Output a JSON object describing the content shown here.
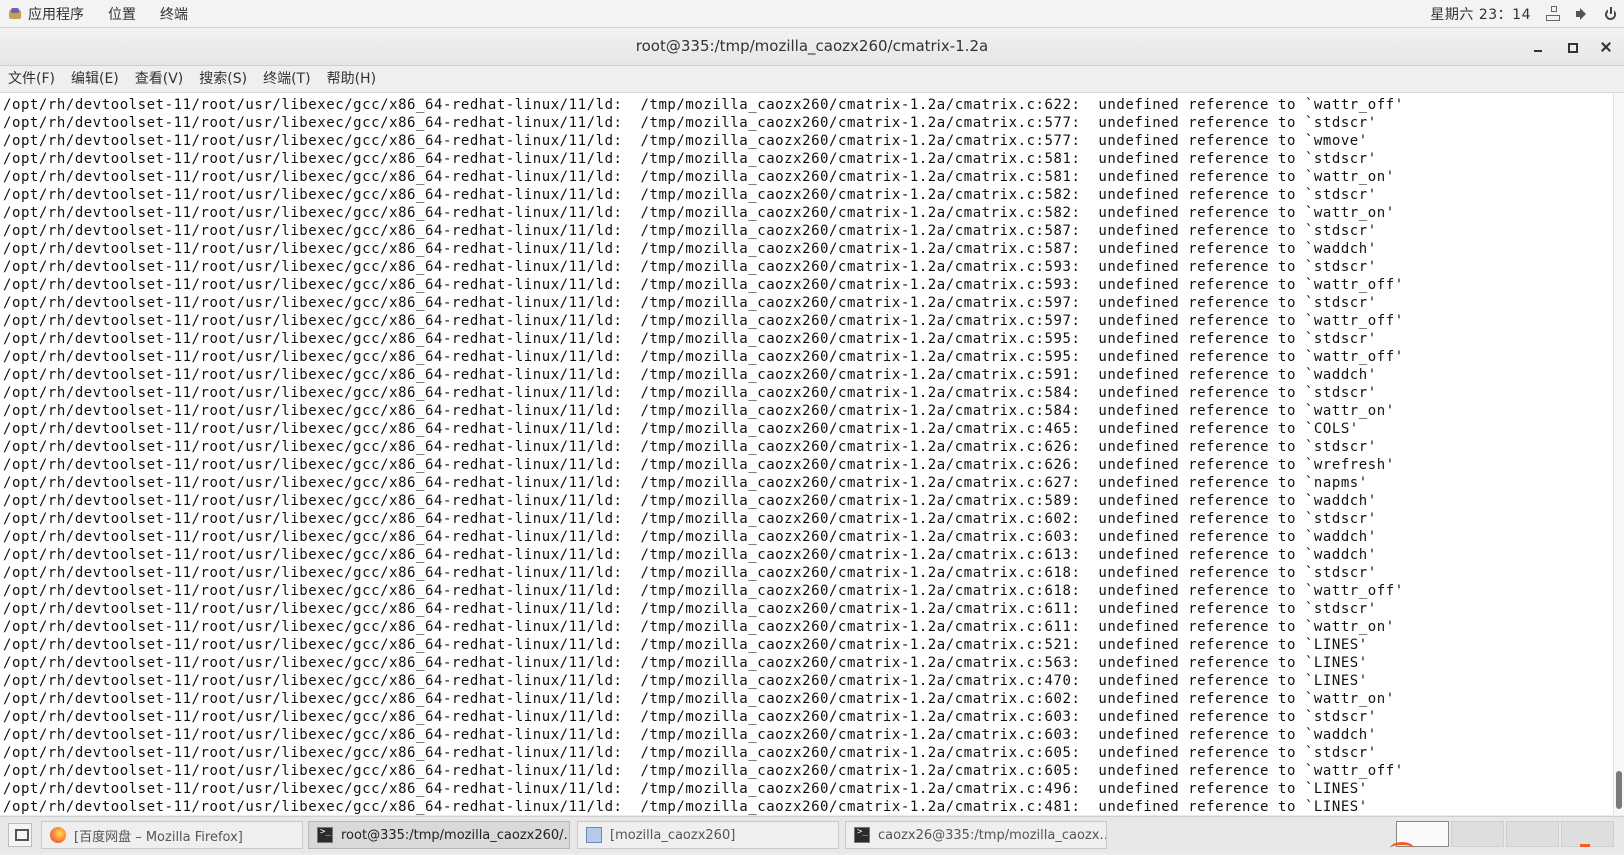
{
  "top_panel": {
    "applications": "应用程序",
    "places": "位置",
    "terminal": "终端",
    "datetime": "星期六 23：14"
  },
  "window": {
    "title": "root@335:/tmp/mozilla_caozx260/cmatrix-1.2a"
  },
  "menu": {
    "items": [
      "文件(F)",
      "编辑(E)",
      "查看(V)",
      "搜索(S)",
      "终端(T)",
      "帮助(H)"
    ]
  },
  "terminal": {
    "lines": [
      "/opt/rh/devtoolset-11/root/usr/libexec/gcc/x86_64-redhat-linux/11/ld:  /tmp/mozilla_caozx260/cmatrix-1.2a/cmatrix.c:622:  undefined reference to `wattr_off'",
      "/opt/rh/devtoolset-11/root/usr/libexec/gcc/x86_64-redhat-linux/11/ld:  /tmp/mozilla_caozx260/cmatrix-1.2a/cmatrix.c:577:  undefined reference to `stdscr'",
      "/opt/rh/devtoolset-11/root/usr/libexec/gcc/x86_64-redhat-linux/11/ld:  /tmp/mozilla_caozx260/cmatrix-1.2a/cmatrix.c:577:  undefined reference to `wmove'",
      "/opt/rh/devtoolset-11/root/usr/libexec/gcc/x86_64-redhat-linux/11/ld:  /tmp/mozilla_caozx260/cmatrix-1.2a/cmatrix.c:581:  undefined reference to `stdscr'",
      "/opt/rh/devtoolset-11/root/usr/libexec/gcc/x86_64-redhat-linux/11/ld:  /tmp/mozilla_caozx260/cmatrix-1.2a/cmatrix.c:581:  undefined reference to `wattr_on'",
      "/opt/rh/devtoolset-11/root/usr/libexec/gcc/x86_64-redhat-linux/11/ld:  /tmp/mozilla_caozx260/cmatrix-1.2a/cmatrix.c:582:  undefined reference to `stdscr'",
      "/opt/rh/devtoolset-11/root/usr/libexec/gcc/x86_64-redhat-linux/11/ld:  /tmp/mozilla_caozx260/cmatrix-1.2a/cmatrix.c:582:  undefined reference to `wattr_on'",
      "/opt/rh/devtoolset-11/root/usr/libexec/gcc/x86_64-redhat-linux/11/ld:  /tmp/mozilla_caozx260/cmatrix-1.2a/cmatrix.c:587:  undefined reference to `stdscr'",
      "/opt/rh/devtoolset-11/root/usr/libexec/gcc/x86_64-redhat-linux/11/ld:  /tmp/mozilla_caozx260/cmatrix-1.2a/cmatrix.c:587:  undefined reference to `waddch'",
      "/opt/rh/devtoolset-11/root/usr/libexec/gcc/x86_64-redhat-linux/11/ld:  /tmp/mozilla_caozx260/cmatrix-1.2a/cmatrix.c:593:  undefined reference to `stdscr'",
      "/opt/rh/devtoolset-11/root/usr/libexec/gcc/x86_64-redhat-linux/11/ld:  /tmp/mozilla_caozx260/cmatrix-1.2a/cmatrix.c:593:  undefined reference to `wattr_off'",
      "/opt/rh/devtoolset-11/root/usr/libexec/gcc/x86_64-redhat-linux/11/ld:  /tmp/mozilla_caozx260/cmatrix-1.2a/cmatrix.c:597:  undefined reference to `stdscr'",
      "/opt/rh/devtoolset-11/root/usr/libexec/gcc/x86_64-redhat-linux/11/ld:  /tmp/mozilla_caozx260/cmatrix-1.2a/cmatrix.c:597:  undefined reference to `wattr_off'",
      "/opt/rh/devtoolset-11/root/usr/libexec/gcc/x86_64-redhat-linux/11/ld:  /tmp/mozilla_caozx260/cmatrix-1.2a/cmatrix.c:595:  undefined reference to `stdscr'",
      "/opt/rh/devtoolset-11/root/usr/libexec/gcc/x86_64-redhat-linux/11/ld:  /tmp/mozilla_caozx260/cmatrix-1.2a/cmatrix.c:595:  undefined reference to `wattr_off'",
      "/opt/rh/devtoolset-11/root/usr/libexec/gcc/x86_64-redhat-linux/11/ld:  /tmp/mozilla_caozx260/cmatrix-1.2a/cmatrix.c:591:  undefined reference to `waddch'",
      "/opt/rh/devtoolset-11/root/usr/libexec/gcc/x86_64-redhat-linux/11/ld:  /tmp/mozilla_caozx260/cmatrix-1.2a/cmatrix.c:584:  undefined reference to `stdscr'",
      "/opt/rh/devtoolset-11/root/usr/libexec/gcc/x86_64-redhat-linux/11/ld:  /tmp/mozilla_caozx260/cmatrix-1.2a/cmatrix.c:584:  undefined reference to `wattr_on'",
      "/opt/rh/devtoolset-11/root/usr/libexec/gcc/x86_64-redhat-linux/11/ld:  /tmp/mozilla_caozx260/cmatrix-1.2a/cmatrix.c:465:  undefined reference to `COLS'",
      "/opt/rh/devtoolset-11/root/usr/libexec/gcc/x86_64-redhat-linux/11/ld:  /tmp/mozilla_caozx260/cmatrix-1.2a/cmatrix.c:626:  undefined reference to `stdscr'",
      "/opt/rh/devtoolset-11/root/usr/libexec/gcc/x86_64-redhat-linux/11/ld:  /tmp/mozilla_caozx260/cmatrix-1.2a/cmatrix.c:626:  undefined reference to `wrefresh'",
      "/opt/rh/devtoolset-11/root/usr/libexec/gcc/x86_64-redhat-linux/11/ld:  /tmp/mozilla_caozx260/cmatrix-1.2a/cmatrix.c:627:  undefined reference to `napms'",
      "/opt/rh/devtoolset-11/root/usr/libexec/gcc/x86_64-redhat-linux/11/ld:  /tmp/mozilla_caozx260/cmatrix-1.2a/cmatrix.c:589:  undefined reference to `waddch'",
      "/opt/rh/devtoolset-11/root/usr/libexec/gcc/x86_64-redhat-linux/11/ld:  /tmp/mozilla_caozx260/cmatrix-1.2a/cmatrix.c:602:  undefined reference to `stdscr'",
      "/opt/rh/devtoolset-11/root/usr/libexec/gcc/x86_64-redhat-linux/11/ld:  /tmp/mozilla_caozx260/cmatrix-1.2a/cmatrix.c:603:  undefined reference to `waddch'",
      "/opt/rh/devtoolset-11/root/usr/libexec/gcc/x86_64-redhat-linux/11/ld:  /tmp/mozilla_caozx260/cmatrix-1.2a/cmatrix.c:613:  undefined reference to `waddch'",
      "/opt/rh/devtoolset-11/root/usr/libexec/gcc/x86_64-redhat-linux/11/ld:  /tmp/mozilla_caozx260/cmatrix-1.2a/cmatrix.c:618:  undefined reference to `stdscr'",
      "/opt/rh/devtoolset-11/root/usr/libexec/gcc/x86_64-redhat-linux/11/ld:  /tmp/mozilla_caozx260/cmatrix-1.2a/cmatrix.c:618:  undefined reference to `wattr_off'",
      "/opt/rh/devtoolset-11/root/usr/libexec/gcc/x86_64-redhat-linux/11/ld:  /tmp/mozilla_caozx260/cmatrix-1.2a/cmatrix.c:611:  undefined reference to `stdscr'",
      "/opt/rh/devtoolset-11/root/usr/libexec/gcc/x86_64-redhat-linux/11/ld:  /tmp/mozilla_caozx260/cmatrix-1.2a/cmatrix.c:611:  undefined reference to `wattr_on'",
      "/opt/rh/devtoolset-11/root/usr/libexec/gcc/x86_64-redhat-linux/11/ld:  /tmp/mozilla_caozx260/cmatrix-1.2a/cmatrix.c:521:  undefined reference to `LINES'",
      "/opt/rh/devtoolset-11/root/usr/libexec/gcc/x86_64-redhat-linux/11/ld:  /tmp/mozilla_caozx260/cmatrix-1.2a/cmatrix.c:563:  undefined reference to `LINES'",
      "/opt/rh/devtoolset-11/root/usr/libexec/gcc/x86_64-redhat-linux/11/ld:  /tmp/mozilla_caozx260/cmatrix-1.2a/cmatrix.c:470:  undefined reference to `LINES'",
      "/opt/rh/devtoolset-11/root/usr/libexec/gcc/x86_64-redhat-linux/11/ld:  /tmp/mozilla_caozx260/cmatrix-1.2a/cmatrix.c:602:  undefined reference to `wattr_on'",
      "/opt/rh/devtoolset-11/root/usr/libexec/gcc/x86_64-redhat-linux/11/ld:  /tmp/mozilla_caozx260/cmatrix-1.2a/cmatrix.c:603:  undefined reference to `stdscr'",
      "/opt/rh/devtoolset-11/root/usr/libexec/gcc/x86_64-redhat-linux/11/ld:  /tmp/mozilla_caozx260/cmatrix-1.2a/cmatrix.c:603:  undefined reference to `waddch'",
      "/opt/rh/devtoolset-11/root/usr/libexec/gcc/x86_64-redhat-linux/11/ld:  /tmp/mozilla_caozx260/cmatrix-1.2a/cmatrix.c:605:  undefined reference to `stdscr'",
      "/opt/rh/devtoolset-11/root/usr/libexec/gcc/x86_64-redhat-linux/11/ld:  /tmp/mozilla_caozx260/cmatrix-1.2a/cmatrix.c:605:  undefined reference to `wattr_off'",
      "/opt/rh/devtoolset-11/root/usr/libexec/gcc/x86_64-redhat-linux/11/ld:  /tmp/mozilla_caozx260/cmatrix-1.2a/cmatrix.c:496:  undefined reference to `LINES'",
      "/opt/rh/devtoolset-11/root/usr/libexec/gcc/x86_64-redhat-linux/11/ld:  /tmp/mozilla_caozx260/cmatrix-1.2a/cmatrix.c:481:  undefined reference to `LINES'"
    ]
  },
  "taskbar": {
    "tasks": [
      {
        "label": "[百度网盘 – Mozilla Firefox]",
        "icon": "firefox-icon"
      },
      {
        "label": "root@335:/tmp/mozilla_caozx260/…",
        "icon": "terminal-icon"
      },
      {
        "label": "[mozilla_caozx260]",
        "icon": "file-manager-icon"
      },
      {
        "label": "caozx26@335:/tmp/mozilla_caozx…",
        "icon": "terminal-icon"
      }
    ]
  },
  "colors": {
    "terminal_bg": "#ffffff",
    "terminal_fg": "#111111",
    "panel_bg": "#f3f3f3"
  }
}
